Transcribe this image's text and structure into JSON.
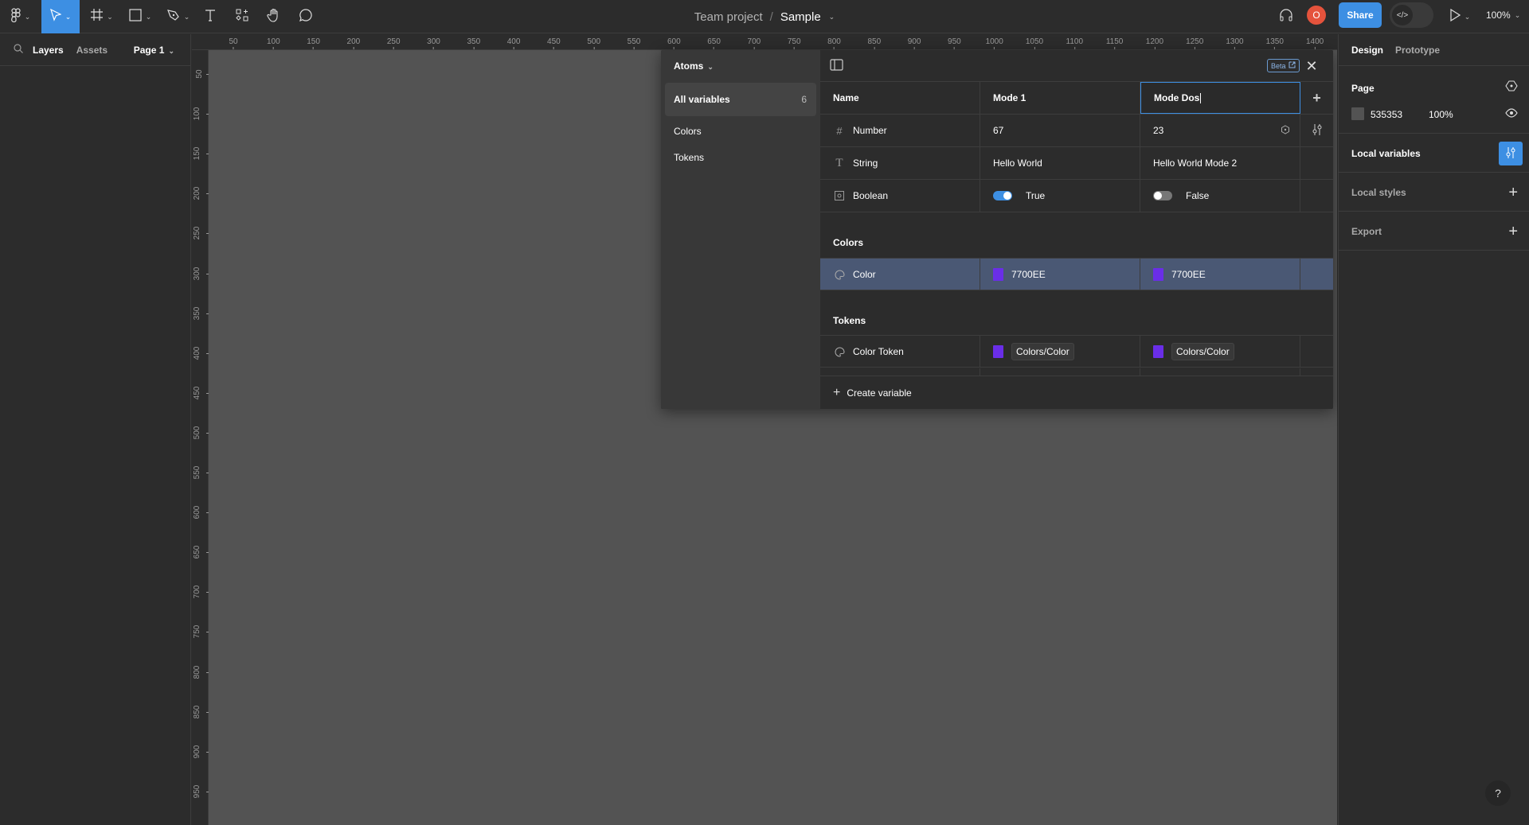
{
  "toolbar": {
    "tools": [
      {
        "name": "figma-menu-icon",
        "glyph": "❖"
      },
      {
        "name": "move-tool-icon",
        "glyph": "▷"
      },
      {
        "name": "frame-tool-icon",
        "glyph": "#"
      },
      {
        "name": "shape-tool-icon",
        "glyph": "□"
      },
      {
        "name": "pen-tool-icon",
        "glyph": "✒"
      },
      {
        "name": "text-tool-icon",
        "glyph": "T"
      },
      {
        "name": "resources-icon",
        "glyph": "⁘"
      },
      {
        "name": "hand-tool-icon",
        "glyph": "✋"
      },
      {
        "name": "comment-tool-icon",
        "glyph": "◯"
      }
    ],
    "chevron": "⌄",
    "project": "Team project",
    "separator": "/",
    "file": "Sample",
    "avatar_initial": "O",
    "share_label": "Share",
    "dev_mode_glyph": "</>",
    "play_glyph": "▷",
    "zoom": "100%",
    "headphones_glyph": "🎧"
  },
  "left_panel": {
    "search_glyph": "⚲",
    "tabs": [
      "Layers",
      "Assets"
    ],
    "page": "Page 1"
  },
  "rulers": {
    "horizontal": [
      "50",
      "100",
      "150",
      "200",
      "250",
      "300",
      "350",
      "400",
      "450",
      "500",
      "550",
      "600",
      "650",
      "700",
      "750",
      "800",
      "850",
      "900",
      "950",
      "1000",
      "1050",
      "1100",
      "1150",
      "1200",
      "1250",
      "1300",
      "1350",
      "1400"
    ],
    "vertical": [
      "50",
      "100",
      "150",
      "200",
      "250",
      "300",
      "350",
      "400",
      "450",
      "500",
      "550",
      "600",
      "650",
      "700",
      "750",
      "800",
      "850",
      "900",
      "950"
    ]
  },
  "right_panel": {
    "tabs": [
      "Design",
      "Prototype"
    ],
    "page_label": "Page",
    "page_color": "535353",
    "page_opacity": "100%",
    "local_variables": "Local variables",
    "local_styles": "Local styles",
    "export": "Export",
    "plus": "+",
    "help": "?"
  },
  "variables_modal": {
    "collection": "Atoms",
    "groups_nav": [
      {
        "label": "All variables",
        "count": "6",
        "selected": true
      },
      {
        "label": "Colors"
      },
      {
        "label": "Tokens"
      }
    ],
    "beta_label": "Beta",
    "close_glyph": "✕",
    "columns": {
      "name": "Name",
      "mode1": "Mode 1",
      "mode2": "Mode Dos"
    },
    "rows": [
      {
        "type_glyph": "#",
        "name": "Number",
        "mode1": "67",
        "mode2": "23"
      },
      {
        "type_glyph": "T",
        "name": "String",
        "mode1": "Hello World",
        "mode2": "Hello World Mode 2"
      },
      {
        "type_glyph": "▣",
        "name": "Boolean",
        "mode1": "True",
        "mode2": "False",
        "mode1_on": true,
        "mode2_on": false
      }
    ],
    "colors_group": {
      "label": "Colors",
      "rows": [
        {
          "type_glyph": "🎨",
          "name": "Color",
          "mode1": "7700EE",
          "mode2": "7700EE"
        }
      ]
    },
    "tokens_group": {
      "label": "Tokens",
      "rows": [
        {
          "type_glyph": "🎨",
          "name": "Color Token",
          "mode1": "Colors/Color",
          "mode2": "Colors/Color"
        }
      ]
    },
    "create_label": "Create variable",
    "swatch_color": "#6a2ee8"
  }
}
